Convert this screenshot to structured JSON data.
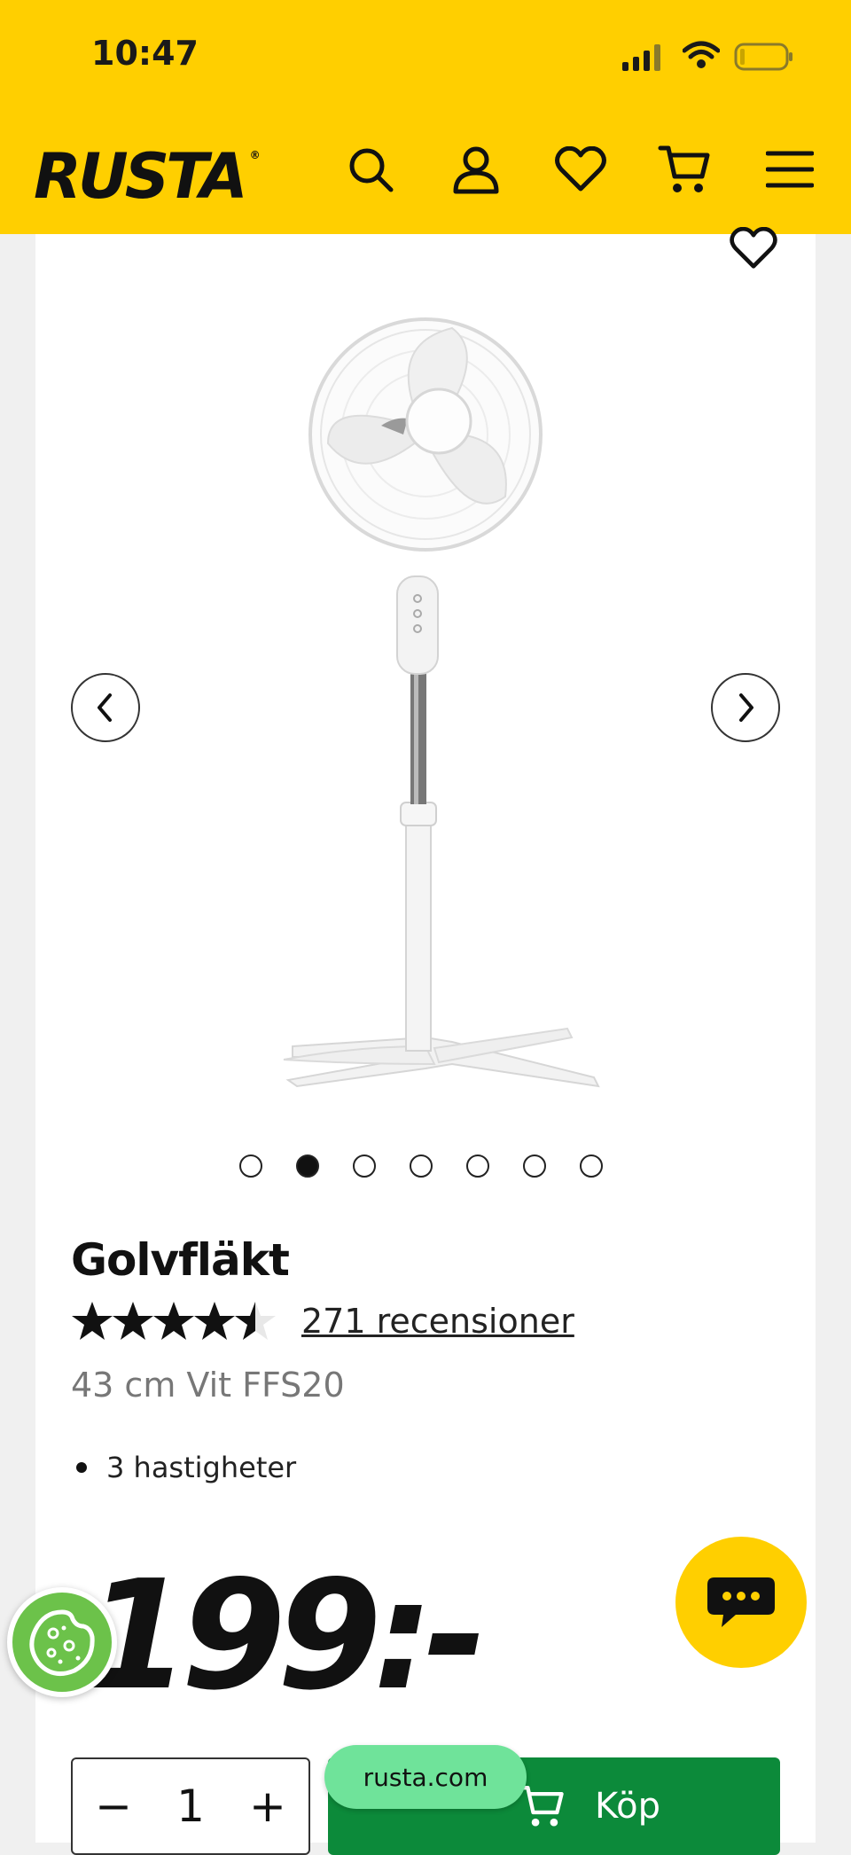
{
  "status_bar": {
    "time": "10:47"
  },
  "header": {
    "logo": "RUSTA",
    "logo_mark": "®"
  },
  "product": {
    "title": "Golvfläkt",
    "rating_value": 4.5,
    "rating_max": 5,
    "reviews_link": "271 recensioner",
    "subtitle": "43 cm Vit FFS20",
    "features": [
      "3 hastigheter"
    ],
    "price": "199:-",
    "gallery": {
      "count": 7,
      "active_index": 1
    }
  },
  "purchase": {
    "quantity": "1",
    "minus": "−",
    "plus": "+",
    "buy_label": "Köp"
  },
  "browser": {
    "url": "rusta.com"
  },
  "colors": {
    "brand_yellow": "#ffcf00",
    "buy_green": "#0c8a3a",
    "cookie_green": "#6cc24a"
  }
}
